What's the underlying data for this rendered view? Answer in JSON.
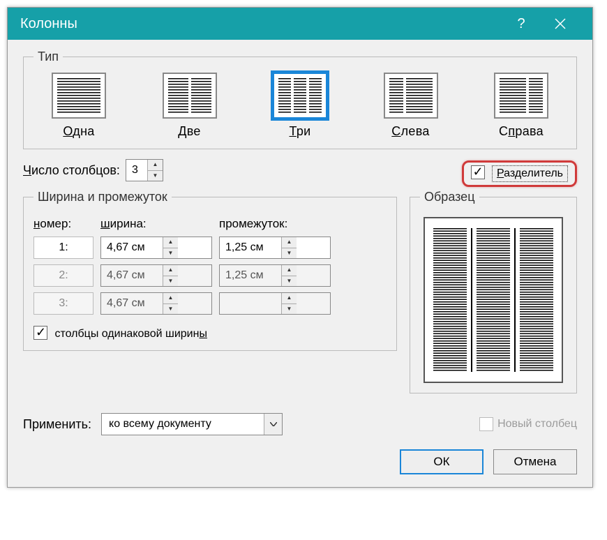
{
  "titlebar": {
    "title": "Колонны"
  },
  "type_group": {
    "legend": "Тип",
    "presets": [
      {
        "key": "one",
        "label_pre": "",
        "label_ul": "О",
        "label_post": "дна"
      },
      {
        "key": "two",
        "label_pre": "",
        "label_ul": "Д",
        "label_post": "ве"
      },
      {
        "key": "three",
        "label_pre": "",
        "label_ul": "Т",
        "label_post": "ри"
      },
      {
        "key": "left",
        "label_pre": "",
        "label_ul": "С",
        "label_post": "лева"
      },
      {
        "key": "right",
        "label_pre": "С",
        "label_ul": "п",
        "label_post": "рава"
      }
    ]
  },
  "num_cols": {
    "label_pre": "",
    "label_ul": "Ч",
    "label_post": "исло столбцов:",
    "value": "3"
  },
  "separator": {
    "label_pre": "",
    "label_ul": "Р",
    "label_post": "азделитель"
  },
  "width_group": {
    "legend": "Ширина и промежуток",
    "hdr_num_pre": "",
    "hdr_num_ul": "н",
    "hdr_num_post": "омер:",
    "hdr_width_pre": "",
    "hdr_width_ul": "ш",
    "hdr_width_post": "ирина:",
    "hdr_gap": "промежуток:",
    "rows": [
      {
        "num": "1:",
        "width": "4,67 см",
        "gap": "1,25 см",
        "enabled": true
      },
      {
        "num": "2:",
        "width": "4,67 см",
        "gap": "1,25 см",
        "enabled": false
      },
      {
        "num": "3:",
        "width": "4,67 см",
        "gap": "",
        "enabled": false
      }
    ],
    "equal_pre": "столбцы одинаковой ширин",
    "equal_ul": "ы",
    "equal_post": ""
  },
  "sample": {
    "legend": "Образец"
  },
  "apply": {
    "label": "Применить:",
    "value": "ко всему документу"
  },
  "newcol": {
    "label": "Новый столбец"
  },
  "footer": {
    "ok": "ОК",
    "cancel": "Отмена"
  }
}
